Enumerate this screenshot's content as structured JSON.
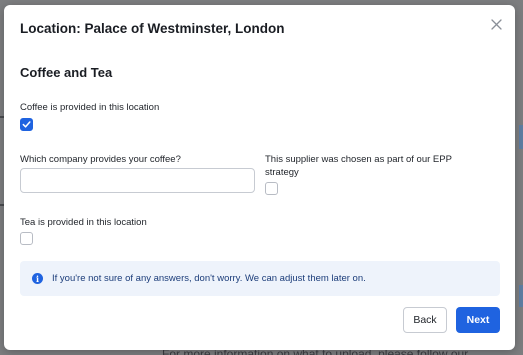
{
  "background": {
    "bottom_text": "For more information on what to upload, please follow our "
  },
  "modal": {
    "title": "Location: Palace of Westminster, London",
    "section_title": "Coffee and Tea",
    "coffee_provided": {
      "label": "Coffee is provided in this location",
      "checked": true
    },
    "company_field": {
      "label": "Which company provides your coffee?",
      "value": "",
      "placeholder": ""
    },
    "epp": {
      "label": "This supplier was chosen as part of our EPP strategy",
      "checked": false
    },
    "tea_provided": {
      "label": "Tea is provided in this location",
      "checked": false
    },
    "info": {
      "icon": "info-icon",
      "text": "If you're not sure of any answers, don't worry. We can adjust them later on."
    },
    "buttons": {
      "back": "Back",
      "next": "Next"
    },
    "close_icon": "close-icon"
  },
  "colors": {
    "accent": "#1f63e0",
    "info_bg": "#eef3fb",
    "info_text": "#1c3d7a",
    "backdrop": "#7d7e80"
  }
}
